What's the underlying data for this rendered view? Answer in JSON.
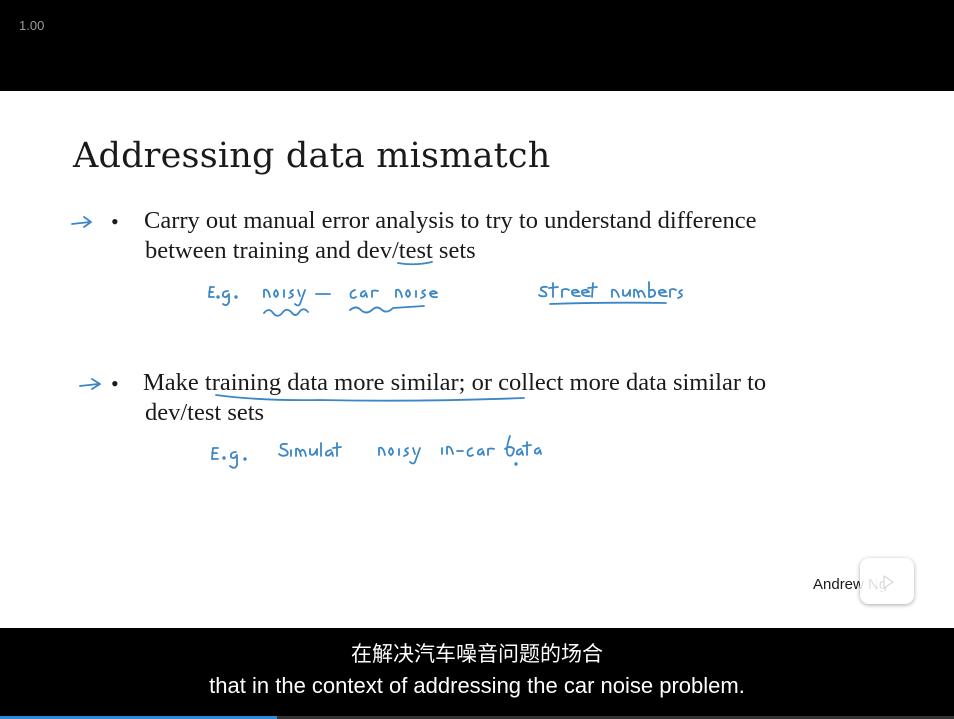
{
  "player": {
    "speed_label": "1.00",
    "progress_fraction": 0.29,
    "accent_color": "#2d8bd6"
  },
  "slide": {
    "title": "Addressing data mismatch",
    "bullets": [
      {
        "line1": "Carry out manual error analysis to try to understand difference",
        "line2": "between training and dev/test sets",
        "handwritten": [
          "E.g. noisy - car noise",
          "street numbers"
        ]
      },
      {
        "line1": "Make training data more similar; or collect more data similar to",
        "line2": "dev/test sets",
        "handwritten": [
          "E.g. Simulate noisy in-car data"
        ]
      }
    ],
    "author": "Andrew Ng",
    "ink_color": "#3b86c6"
  },
  "subtitles": {
    "chinese": "在解决汽车噪音问题的场合",
    "english": "that in the context of addressing the car noise problem."
  },
  "icons": [
    "play-icon",
    "arrow-icon"
  ]
}
